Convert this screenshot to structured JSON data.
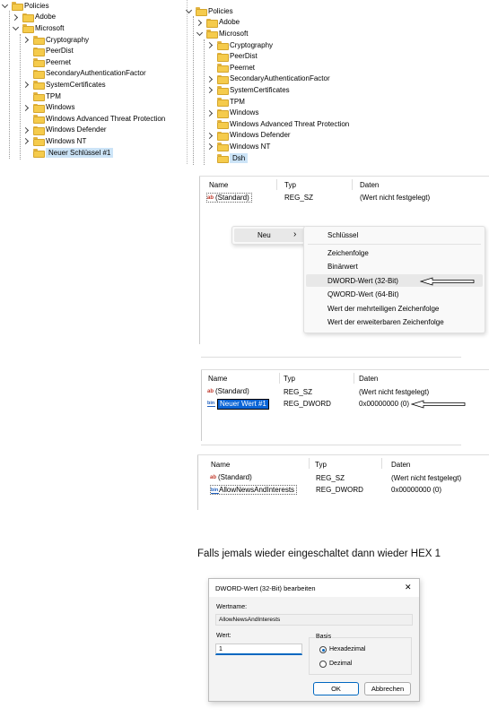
{
  "tree_left": {
    "items": [
      {
        "label": "Policies",
        "expander": "down"
      },
      {
        "label": "Adobe",
        "expander": "right"
      },
      {
        "label": "Microsoft",
        "expander": "down"
      },
      {
        "label": "Cryptography",
        "expander": "right"
      },
      {
        "label": "PeerDist",
        "expander": "none"
      },
      {
        "label": "Peernet",
        "expander": "none"
      },
      {
        "label": "SecondaryAuthenticationFactor",
        "expander": "none"
      },
      {
        "label": "SystemCertificates",
        "expander": "right"
      },
      {
        "label": "TPM",
        "expander": "none"
      },
      {
        "label": "Windows",
        "expander": "right"
      },
      {
        "label": "Windows Advanced Threat Protection",
        "expander": "none"
      },
      {
        "label": "Windows Defender",
        "expander": "right"
      },
      {
        "label": "Windows NT",
        "expander": "right"
      },
      {
        "label": "Neuer Schlüssel #1",
        "expander": "none",
        "selected": true
      }
    ]
  },
  "tree_right": {
    "items": [
      {
        "label": "Policies",
        "expander": "down"
      },
      {
        "label": "Adobe",
        "expander": "right"
      },
      {
        "label": "Microsoft",
        "expander": "down"
      },
      {
        "label": "Cryptography",
        "expander": "right"
      },
      {
        "label": "PeerDist",
        "expander": "none"
      },
      {
        "label": "Peernet",
        "expander": "none"
      },
      {
        "label": "SecondaryAuthenticationFactor",
        "expander": "right"
      },
      {
        "label": "SystemCertificates",
        "expander": "right"
      },
      {
        "label": "TPM",
        "expander": "none"
      },
      {
        "label": "Windows",
        "expander": "right"
      },
      {
        "label": "Windows Advanced Threat Protection",
        "expander": "none"
      },
      {
        "label": "Windows Defender",
        "expander": "right"
      },
      {
        "label": "Windows NT",
        "expander": "right"
      },
      {
        "label": "Dsh",
        "expander": "none",
        "selected": true
      }
    ]
  },
  "columns": {
    "name": "Name",
    "type": "Typ",
    "data": "Daten"
  },
  "panel1": {
    "rows": [
      {
        "icon": "ab",
        "name": "(Standard)",
        "type": "REG_SZ",
        "data": "(Wert nicht festgelegt)"
      }
    ],
    "context": {
      "neu_label": "Neu",
      "neu_arrow": "›",
      "submenu": [
        "Schlüssel",
        "Zeichenfolge",
        "Binärwert",
        "DWORD-Wert (32-Bit)",
        "QWORD-Wert (64-Bit)",
        "Wert der mehrteiligen Zeichenfolge",
        "Wert der erweiterbaren Zeichenfolge"
      ]
    }
  },
  "panel2": {
    "rows": [
      {
        "icon": "ab",
        "name": "(Standard)",
        "type": "REG_SZ",
        "data": "(Wert nicht festgelegt)"
      },
      {
        "icon": "bin",
        "name": "Neuer Wert #1",
        "type": "REG_DWORD",
        "data": "0x00000000 (0)"
      }
    ]
  },
  "panel3": {
    "rows": [
      {
        "icon": "ab",
        "name": "(Standard)",
        "type": "REG_SZ",
        "data": "(Wert nicht festgelegt)"
      },
      {
        "icon": "bin",
        "name": "AllowNewsAndInterests",
        "type": "REG_DWORD",
        "data": "0x00000000 (0)"
      }
    ]
  },
  "note": "Falls jemals wieder eingeschaltet dann wieder HEX 1",
  "dialog": {
    "title": "DWORD-Wert (32-Bit) bearbeiten",
    "close": "✕",
    "name_label": "Wertname:",
    "name_value": "AllowNewsAndInterests",
    "value_label": "Wert:",
    "value_value": "1",
    "base_label": "Basis",
    "hex_label": "Hexadezimal",
    "dec_label": "Dezimal",
    "ok": "OK",
    "cancel": "Abbrechen"
  },
  "icons": {
    "ab": "ab",
    "bin": "110"
  }
}
